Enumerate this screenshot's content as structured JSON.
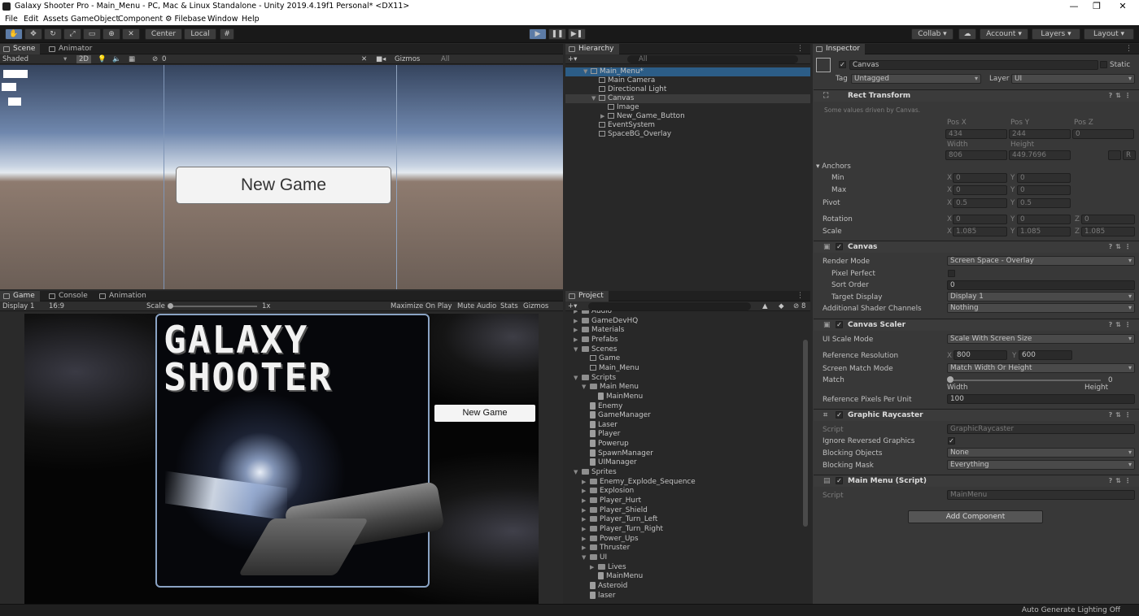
{
  "window": {
    "title": "Galaxy Shooter Pro - Main_Menu - PC, Mac & Linux Standalone - Unity 2019.4.19f1 Personal* <DX11>",
    "controls": {
      "minimize": "—",
      "maximize": "❐",
      "close": "✕"
    }
  },
  "menu": [
    "File",
    "Edit",
    "Assets",
    "GameObject",
    "Component",
    "Filebase",
    "Window",
    "Help"
  ],
  "toolbar": {
    "pivot": "Center",
    "space": "Local",
    "collab": "Collab ▾",
    "account": "Account",
    "layers": "Layers",
    "layout": "Layout"
  },
  "scene": {
    "tabs": [
      "Scene",
      "Animator"
    ],
    "shading": "Shaded",
    "mode2d": "2D",
    "gizmos": "Gizmos",
    "search_placeholder": "All",
    "hidden_count": "0",
    "button_text": "New Game"
  },
  "game": {
    "tabs": [
      "Game",
      "Console",
      "Animation"
    ],
    "display": "Display 1",
    "aspect": "16:9",
    "scale_label": "Scale",
    "scale_value": "1x",
    "maximize": "Maximize On Play",
    "mute": "Mute Audio",
    "stats": "Stats",
    "gizmos": "Gizmos",
    "title_line1": "GALAXY",
    "title_line2": "SHOOTER",
    "button_text": "New Game"
  },
  "hierarchy": {
    "title": "Hierarchy",
    "search_placeholder": "All",
    "items": [
      "Main_Menu*",
      "Main Camera",
      "Directional Light",
      "Canvas",
      "Image",
      "New_Game_Button",
      "EventSystem",
      "SpaceBG_Overlay"
    ]
  },
  "project": {
    "title": "Project",
    "badge": "8",
    "items": [
      "Audio",
      "GameDevHQ",
      "Materials",
      "Prefabs",
      "Scenes",
      "Game",
      "Main_Menu",
      "Scripts",
      "Main Menu",
      "MainMenu",
      "Enemy",
      "GameManager",
      "Laser",
      "Player",
      "Powerup",
      "SpawnManager",
      "UIManager",
      "Sprites",
      "Enemy_Explode_Sequence",
      "Explosion",
      "Player_Hurt",
      "Player_Shield",
      "Player_Turn_Left",
      "Player_Turn_Right",
      "Power_Ups",
      "Thruster",
      "UI",
      "Lives",
      "MainMenu",
      "Asteroid",
      "laser"
    ]
  },
  "inspector": {
    "title": "Inspector",
    "object_name": "Canvas",
    "static_label": "Static",
    "tag_label": "Tag",
    "tag_value": "Untagged",
    "layer_label": "Layer",
    "layer_value": "UI",
    "rect": {
      "title": "Rect Transform",
      "note": "Some values driven by Canvas.",
      "pos_x_label": "Pos X",
      "pos_y_label": "Pos Y",
      "pos_z_label": "Pos Z",
      "pos_x": "434",
      "pos_y": "244",
      "pos_z": "0",
      "width_label": "Width",
      "height_label": "Height",
      "width": "806",
      "height": "449.7696",
      "r_btn": "R",
      "anchors": "Anchors",
      "min": "Min",
      "max": "Max",
      "min_x": "0",
      "min_y": "0",
      "max_x": "0",
      "max_y": "0",
      "pivot": "Pivot",
      "pivot_x": "0.5",
      "pivot_y": "0.5",
      "rotation": "Rotation",
      "rot_x": "0",
      "rot_y": "0",
      "rot_z": "0",
      "scale": "Scale",
      "scale_x": "1.085",
      "scale_y": "1.085",
      "scale_z": "1.085",
      "x": "X",
      "y": "Y",
      "z": "Z"
    },
    "canvas": {
      "title": "Canvas",
      "render_mode_label": "Render Mode",
      "render_mode": "Screen Space - Overlay",
      "pixel_perfect": "Pixel Perfect",
      "sort_order_label": "Sort Order",
      "sort_order": "0",
      "target_display_label": "Target Display",
      "target_display": "Display 1",
      "shader_channels_label": "Additional Shader Channels",
      "shader_channels": "Nothing"
    },
    "scaler": {
      "title": "Canvas Scaler",
      "ui_scale_mode_label": "UI Scale Mode",
      "ui_scale_mode": "Scale With Screen Size",
      "ref_res_label": "Reference Resolution",
      "ref_x": "800",
      "ref_y": "600",
      "match_mode_label": "Screen Match Mode",
      "match_mode": "Match Width Or Height",
      "match_label": "Match",
      "match_value": "0",
      "match_level": 0,
      "width_label": "Width",
      "height_label": "Height",
      "ppu_label": "Reference Pixels Per Unit",
      "ppu": "100"
    },
    "raycaster": {
      "title": "Graphic Raycaster",
      "script_label": "Script",
      "script_value": "GraphicRaycaster",
      "ignore_reversed": "Ignore Reversed Graphics",
      "blocking_objects_label": "Blocking Objects",
      "blocking_objects": "None",
      "blocking_mask_label": "Blocking Mask",
      "blocking_mask": "Everything"
    },
    "mainmenu": {
      "title": "Main Menu (Script)",
      "script_label": "Script",
      "script_value": "MainMenu"
    },
    "add_component": "Add Component"
  },
  "status": "Auto Generate Lighting Off"
}
